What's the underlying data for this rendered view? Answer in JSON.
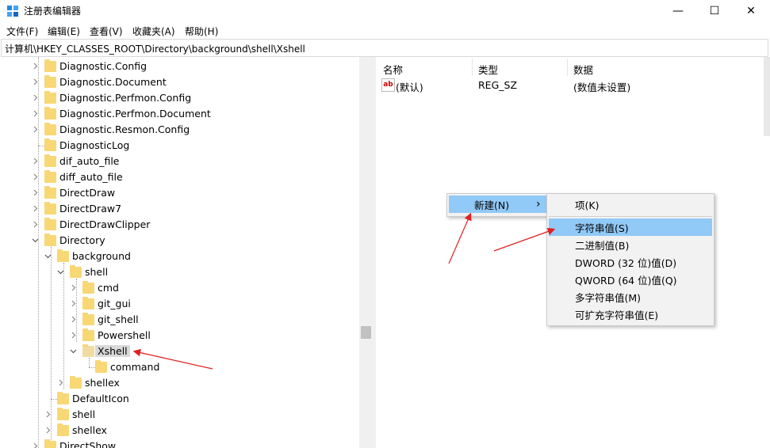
{
  "window": {
    "title": "注册表编辑器",
    "controls": {
      "minimize": "—",
      "maximize": "☐",
      "close": "✕"
    }
  },
  "menu": [
    "文件(F)",
    "编辑(E)",
    "查看(V)",
    "收藏夹(A)",
    "帮助(H)"
  ],
  "address": "计算机\\HKEY_CLASSES_ROOT\\Directory\\background\\shell\\Xshell",
  "tree": [
    {
      "label": "Diagnostic.Config",
      "level": 0,
      "expander": "collapsed"
    },
    {
      "label": "Diagnostic.Document",
      "level": 0,
      "expander": "collapsed"
    },
    {
      "label": "Diagnostic.Perfmon.Config",
      "level": 0,
      "expander": "collapsed"
    },
    {
      "label": "Diagnostic.Perfmon.Document",
      "level": 0,
      "expander": "collapsed"
    },
    {
      "label": "Diagnostic.Resmon.Config",
      "level": 0,
      "expander": "collapsed"
    },
    {
      "label": "DiagnosticLog",
      "level": 0,
      "expander": "none"
    },
    {
      "label": "dif_auto_file",
      "level": 0,
      "expander": "collapsed"
    },
    {
      "label": "diff_auto_file",
      "level": 0,
      "expander": "collapsed"
    },
    {
      "label": "DirectDraw",
      "level": 0,
      "expander": "collapsed"
    },
    {
      "label": "DirectDraw7",
      "level": 0,
      "expander": "collapsed"
    },
    {
      "label": "DirectDrawClipper",
      "level": 0,
      "expander": "collapsed"
    },
    {
      "label": "Directory",
      "level": 0,
      "expander": "expanded"
    },
    {
      "label": "background",
      "level": 1,
      "expander": "expanded"
    },
    {
      "label": "shell",
      "level": 2,
      "expander": "expanded"
    },
    {
      "label": "cmd",
      "level": 3,
      "expander": "collapsed"
    },
    {
      "label": "git_gui",
      "level": 3,
      "expander": "collapsed"
    },
    {
      "label": "git_shell",
      "level": 3,
      "expander": "collapsed"
    },
    {
      "label": "Powershell",
      "level": 3,
      "expander": "collapsed"
    },
    {
      "label": "Xshell",
      "level": 3,
      "expander": "expanded",
      "selected": true
    },
    {
      "label": "command",
      "level": 4,
      "expander": "none"
    },
    {
      "label": "shellex",
      "level": 2,
      "expander": "collapsed"
    },
    {
      "label": "DefaultIcon",
      "level": 1,
      "expander": "none"
    },
    {
      "label": "shell",
      "level": 1,
      "expander": "collapsed"
    },
    {
      "label": "shellex",
      "level": 1,
      "expander": "collapsed"
    },
    {
      "label": "DirectShow",
      "level": 0,
      "expander": "collapsed"
    }
  ],
  "list": {
    "headers": {
      "name": "名称",
      "type": "类型",
      "data": "数据"
    },
    "rows": [
      {
        "icon": "ab",
        "name": "(默认)",
        "type": "REG_SZ",
        "data": "(数值未设置)"
      }
    ]
  },
  "context_menu": {
    "new_label": "新建(N)",
    "new_arrow": "›"
  },
  "submenu": {
    "items": [
      "项(K)",
      "字符串值(S)",
      "二进制值(B)",
      "DWORD (32 位)值(D)",
      "QWORD (64 位)值(Q)",
      "多字符串值(M)",
      "可扩充字符串值(E)"
    ],
    "highlighted": "字符串值(S)"
  },
  "colors": {
    "highlight": "#91c9f7",
    "folder": "#f8d775",
    "annotation_arrow": "#e02020"
  }
}
